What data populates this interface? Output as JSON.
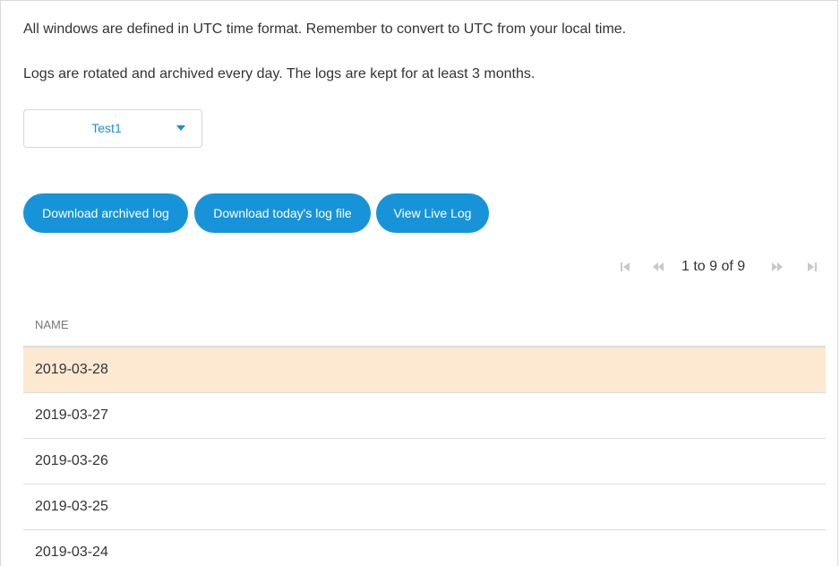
{
  "info": {
    "line1": "All windows are defined in UTC time format. Remember to convert to UTC from your local time.",
    "line2": "Logs are rotated and archived every day. The logs are kept for at least 3 months."
  },
  "select": {
    "value": "Test1"
  },
  "buttons": {
    "download_archived": "Download archived log",
    "download_today": "Download today's log file",
    "view_live": "View Live Log"
  },
  "pager": {
    "text": "1 to 9 of 9"
  },
  "table": {
    "header": "NAME",
    "rows": [
      "2019-03-28",
      "2019-03-27",
      "2019-03-26",
      "2019-03-25",
      "2019-03-24"
    ],
    "selected_index": 0
  },
  "colors": {
    "accent": "#1794d9",
    "selected_row": "#fde8d2",
    "pager_icon": "#c8c8c8"
  }
}
